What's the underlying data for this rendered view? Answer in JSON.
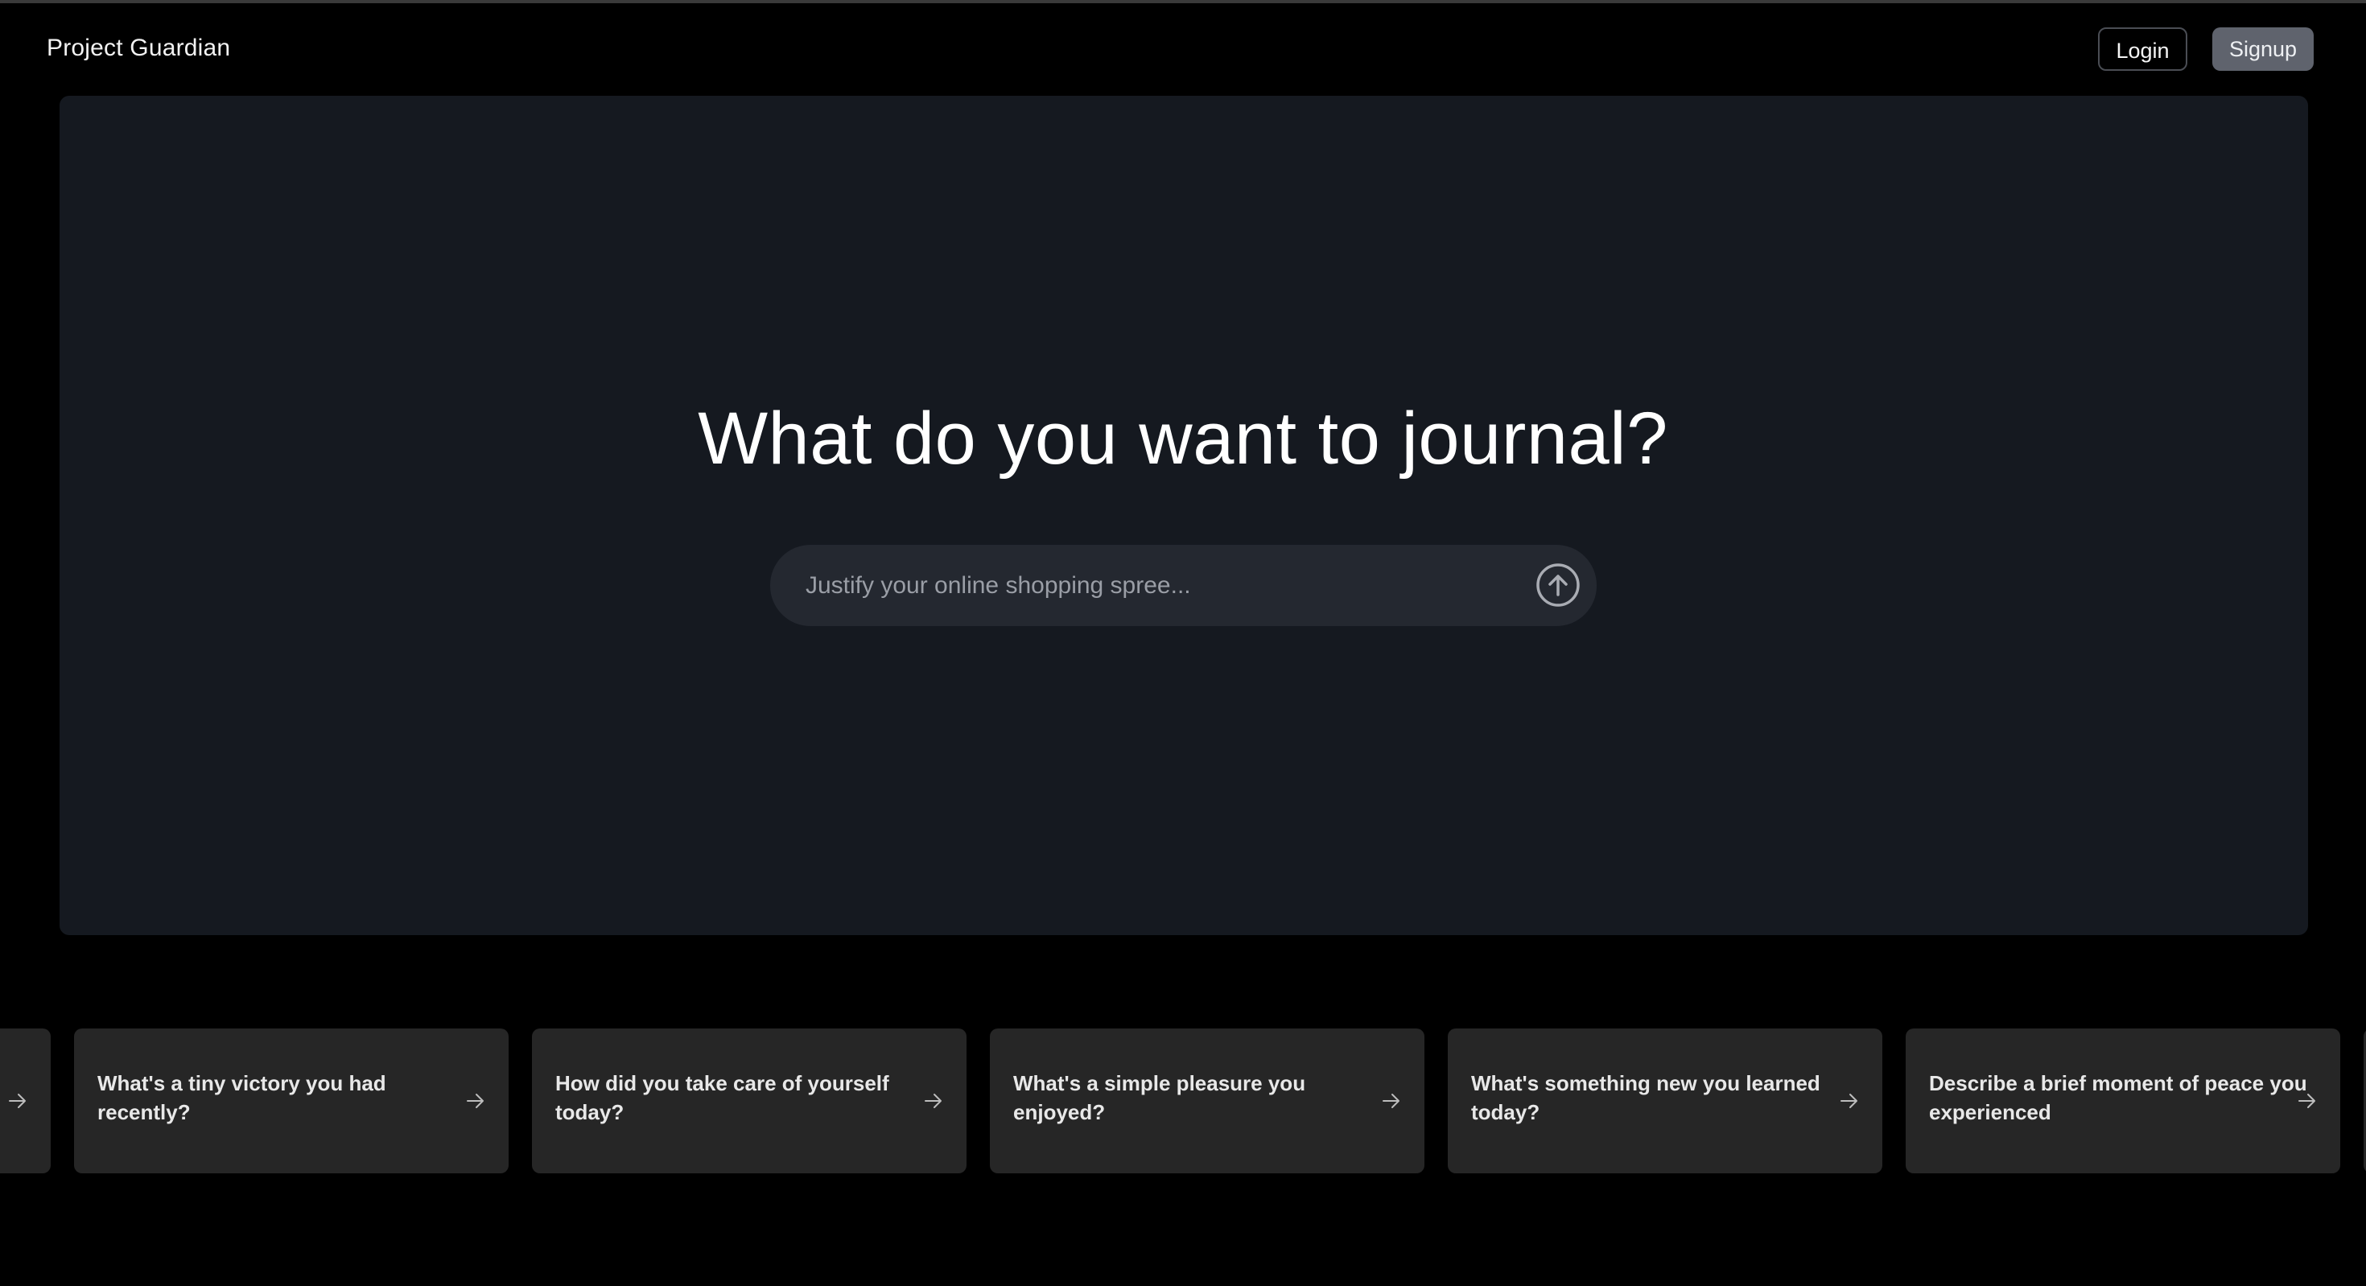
{
  "header": {
    "brand": "Project Guardian",
    "login_label": "Login",
    "signup_label": "Signup"
  },
  "hero": {
    "title": "What do you want to journal?",
    "input_placeholder": "Justify your online shopping spree...",
    "input_value": "",
    "submit_icon": "arrow-up-circle-icon"
  },
  "prompts": [
    {
      "text": ""
    },
    {
      "text": "What's a tiny victory you had recently?"
    },
    {
      "text": "How did you take care of yourself today?"
    },
    {
      "text": "What's a simple pleasure you enjoyed?"
    },
    {
      "text": "What's something new you learned today?"
    },
    {
      "text": "Describe a brief moment of peace you experienced"
    }
  ],
  "icons": {
    "card_arrow": "arrow-right-icon"
  },
  "colors": {
    "background": "#000000",
    "hero_panel": "#151920",
    "input_bg": "#242830",
    "card_bg": "#262626",
    "signup_bg": "#5f636d"
  }
}
